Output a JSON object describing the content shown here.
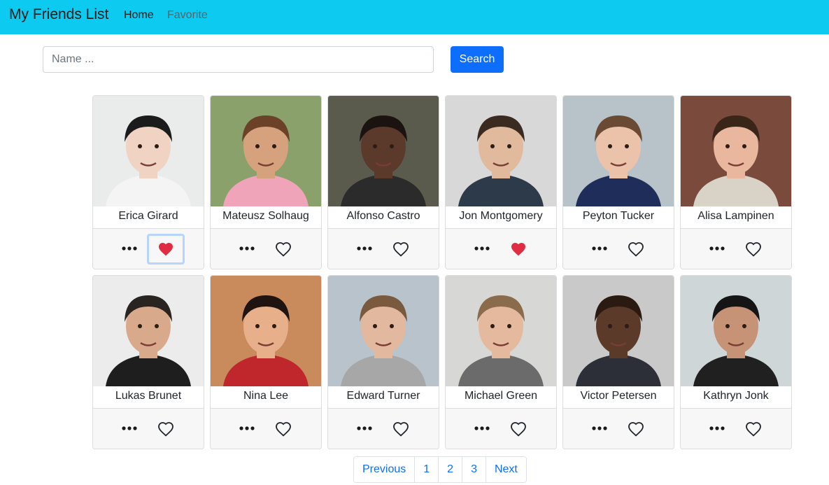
{
  "navbar": {
    "brand": "My Friends List",
    "links": [
      "Home",
      "Favorite"
    ]
  },
  "search": {
    "placeholder": "Name ...",
    "button_label": "Search"
  },
  "friends": [
    {
      "name": "Erica Girard",
      "favorite": true,
      "photo_bg": "#e9eceb",
      "skin": "#f0d3c2",
      "hair": "#1b1b1b",
      "shirt": "#f4f4f4"
    },
    {
      "name": "Mateusz Solhaug",
      "favorite": false,
      "photo_bg": "#8aa16c",
      "skin": "#d6a27d",
      "hair": "#6b4128",
      "shirt": "#efa4ba"
    },
    {
      "name": "Alfonso Castro",
      "favorite": false,
      "photo_bg": "#5a5a4d",
      "skin": "#5b3a2c",
      "hair": "#1a1310",
      "shirt": "#2b2b2b"
    },
    {
      "name": "Jon Montgomery",
      "favorite": true,
      "photo_bg": "#d8d8d8",
      "skin": "#e1b99d",
      "hair": "#3b2a1f",
      "shirt": "#2d3a4a"
    },
    {
      "name": "Peyton Tucker",
      "favorite": false,
      "photo_bg": "#b7c2c9",
      "skin": "#ebc3aa",
      "hair": "#6b4a33",
      "shirt": "#1f2d5a"
    },
    {
      "name": "Alisa Lampinen",
      "favorite": false,
      "photo_bg": "#7a4a3c",
      "skin": "#e9b79d",
      "hair": "#3a2519",
      "shirt": "#d9d2c6"
    },
    {
      "name": "Lukas Brunet",
      "favorite": false,
      "photo_bg": "#ececec",
      "skin": "#d9a98c",
      "hair": "#2a2421",
      "shirt": "#1e1e1e"
    },
    {
      "name": "Nina Lee",
      "favorite": false,
      "photo_bg": "#c98a5c",
      "skin": "#e8b08a",
      "hair": "#1f1410",
      "shirt": "#c0272d"
    },
    {
      "name": "Edward Turner",
      "favorite": false,
      "photo_bg": "#b8c3cb",
      "skin": "#e2b89e",
      "hair": "#7a5a3e",
      "shirt": "#a7a7a7"
    },
    {
      "name": "Michael Green",
      "favorite": false,
      "photo_bg": "#d7d7d5",
      "skin": "#e5b99d",
      "hair": "#8a6b4c",
      "shirt": "#6b6b6b"
    },
    {
      "name": "Victor Petersen",
      "favorite": false,
      "photo_bg": "#c9c9c9",
      "skin": "#5c3a2a",
      "hair": "#2a1a12",
      "shirt": "#2c2f38"
    },
    {
      "name": "Kathryn Jonk",
      "favorite": false,
      "photo_bg": "#cfd6d8",
      "skin": "#c69377",
      "hair": "#151515",
      "shirt": "#202020"
    }
  ],
  "pagination": [
    "Previous",
    "1",
    "2",
    "3",
    "Next"
  ],
  "colors": {
    "navbar": "#0dcaf0",
    "primary": "#0d6efd",
    "heart_active": "#e02d43",
    "heart_outline": "#212529"
  },
  "icons": {
    "more": "more-horizontal-icon",
    "favorite": "heart-icon"
  }
}
